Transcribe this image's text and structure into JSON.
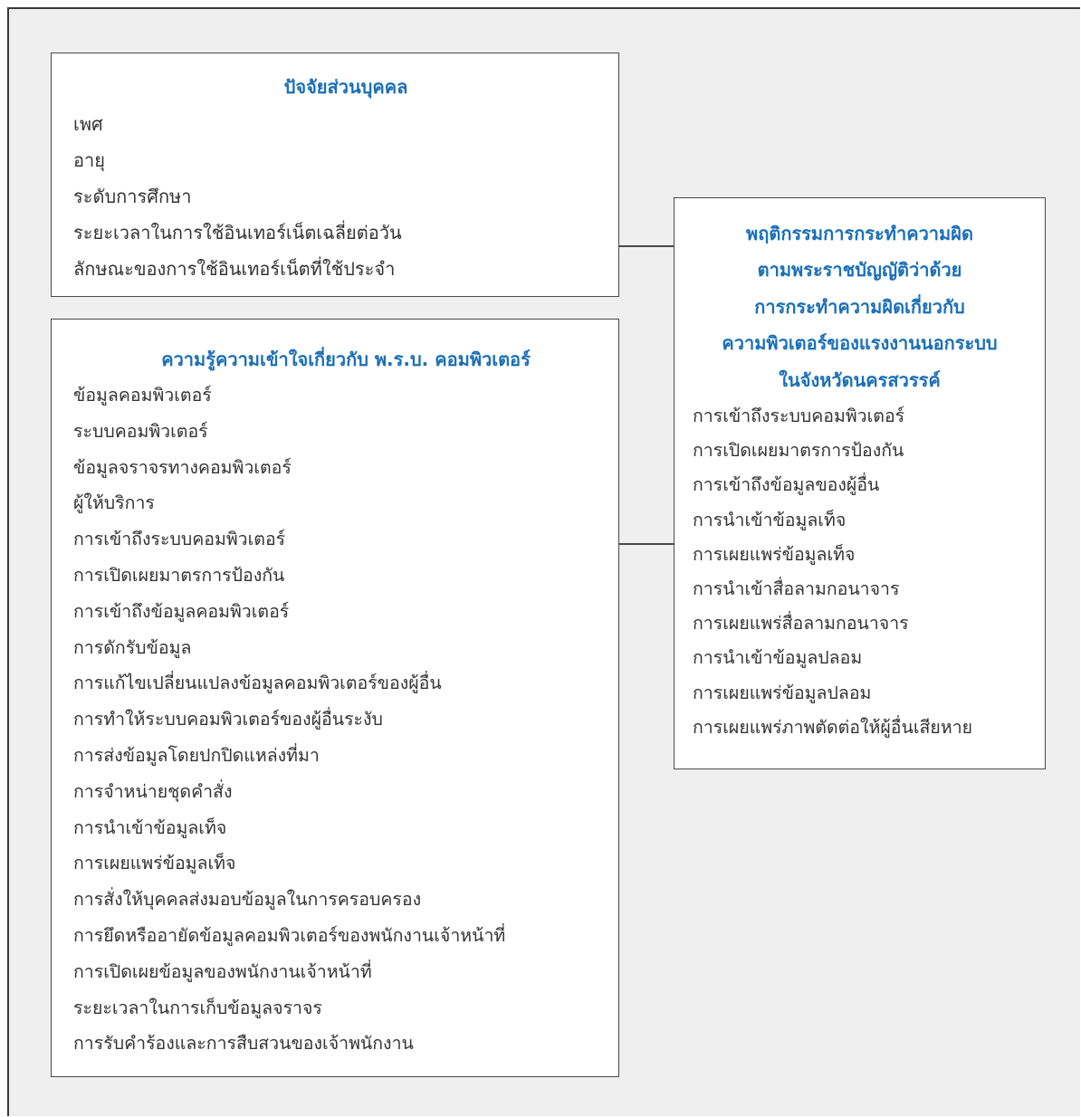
{
  "personal_factors": {
    "title": "ปัจจัยส่วนบุคคล",
    "items": [
      "เพศ",
      "อายุ",
      "ระดับการศึกษา",
      "ระยะเวลาในการใช้อินเทอร์เน็ตเฉลี่ยต่อวัน",
      "ลักษณะของการใช้อินเทอร์เน็ตที่ใช้ประจำ"
    ]
  },
  "knowledge": {
    "title": "ความรู้ความเข้าใจเกี่ยวกับ พ.ร.บ. คอมพิวเตอร์",
    "items": [
      "ข้อมูลคอมพิวเตอร์",
      "ระบบคอมพิวเตอร์",
      "ข้อมูลจราจรทางคอมพิวเตอร์",
      "ผู้ให้บริการ",
      "การเข้าถึงระบบคอมพิวเตอร์",
      "การเปิดเผยมาตรการป้องกัน",
      "การเข้าถึงข้อมูลคอมพิวเตอร์",
      "การดักรับข้อมูล",
      "การแก้ไขเปลี่ยนแปลงข้อมูลคอมพิวเตอร์ของผู้อื่น",
      "การทำให้ระบบคอมพิวเตอร์ของผู้อื่นระงับ",
      "การส่งข้อมูลโดยปกปิดแหล่งที่มา",
      "การจำหน่ายชุดคำสั่ง",
      "การนำเข้าข้อมูลเท็จ",
      "การเผยแพร่ข้อมูลเท็จ",
      "การสั่งให้บุคคลส่งมอบข้อมูลในการครอบครอง",
      "การยึดหรืออายัดข้อมูลคอมพิวเตอร์ของพนักงานเจ้าหน้าที่",
      "การเปิดเผยข้อมูลของพนักงานเจ้าหน้าที่",
      "ระยะเวลาในการเก็บข้อมูลจราจร",
      "การรับคำร้องและการสืบสวนของเจ้าพนักงาน"
    ]
  },
  "behavior": {
    "title_lines": [
      "พฤติกรรมการกระทำความผิด",
      "ตามพระราชบัญญัติว่าด้วย",
      "การกระทำความผิดเกี่ยวกับ",
      "ความพิวเตอร์ของแรงงานนอกระบบ",
      "ในจังหวัดนครสวรรค์"
    ],
    "items": [
      "การเข้าถึงระบบคอมพิวเตอร์",
      "การเปิดเผยมาตรการป้องกัน",
      "การเข้าถึงข้อมูลของผู้อื่น",
      "การนำเข้าข้อมูลเท็จ",
      "การเผยแพร่ข้อมูลเท็จ",
      "การนำเข้าสื่อลามกอนาจาร",
      "การเผยแพร่สื่อลามกอนาจาร",
      "การนำเข้าข้อมูลปลอม",
      "การเผยแพร่ข้อมูลปลอม",
      "การเผยแพร่ภาพตัดต่อให้ผู้อื่นเสียหาย"
    ]
  },
  "colors": {
    "title": "#1a6fb8",
    "text": "#333333",
    "border": "#4a4a4a",
    "background": "#efefef"
  }
}
